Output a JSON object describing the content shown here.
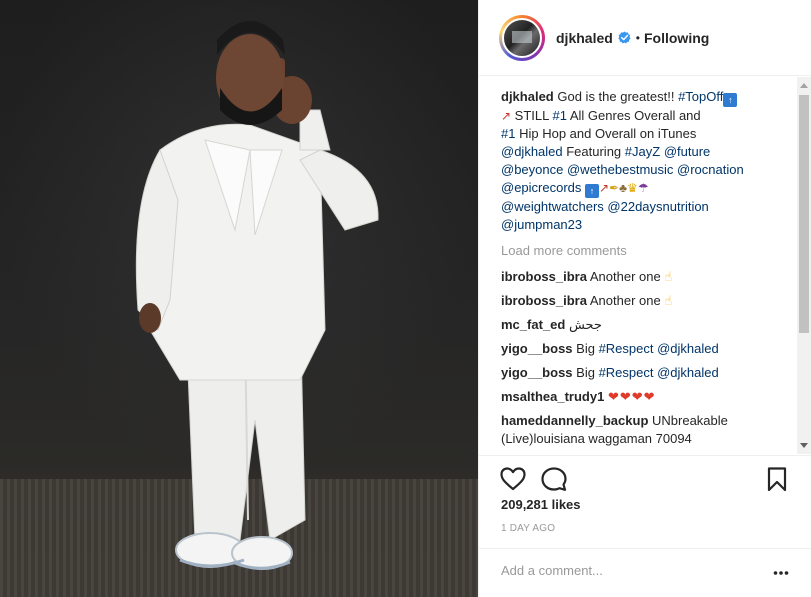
{
  "post": {
    "username": "djkhaled",
    "follow_status": "Following",
    "separator": "•",
    "caption": {
      "username": "djkhaled",
      "lines": [
        {
          "parts": [
            {
              "t": "God is the greatest!! "
            },
            {
              "t": "#TopOff",
              "tag": true
            },
            {
              "e": "top-badge"
            }
          ]
        },
        {
          "parts": [
            {
              "e": "rocket"
            },
            {
              "t": " STILL "
            },
            {
              "t": "#1",
              "tag": true
            },
            {
              "t": " All Genres Overall and"
            }
          ]
        },
        {
          "parts": [
            {
              "t": "#1",
              "tag": true
            },
            {
              "t": " Hip Hop and Overall on iTunes"
            }
          ]
        },
        {
          "parts": [
            {
              "t": "@djkhaled",
              "tag": true
            },
            {
              "t": " Featuring "
            },
            {
              "t": "#JayZ",
              "tag": true
            },
            {
              "t": " "
            },
            {
              "t": "@future",
              "tag": true
            }
          ]
        },
        {
          "parts": [
            {
              "t": "@beyonce",
              "tag": true
            },
            {
              "t": " "
            },
            {
              "t": "@wethebestmusic",
              "tag": true
            },
            {
              "t": " "
            },
            {
              "t": "@rocnation",
              "tag": true
            }
          ]
        },
        {
          "parts": [
            {
              "t": "@epicrecords",
              "tag": true
            },
            {
              "t": " "
            },
            {
              "e": "top-badge"
            },
            {
              "e": "rocket"
            },
            {
              "e": "key"
            },
            {
              "e": "lion"
            },
            {
              "e": "crown-face"
            },
            {
              "e": "umbrella"
            }
          ]
        },
        {
          "parts": [
            {
              "t": "@weightwatchers",
              "tag": true
            },
            {
              "t": " "
            },
            {
              "t": "@22daysnutrition",
              "tag": true
            }
          ]
        },
        {
          "parts": [
            {
              "t": "@jumpman23",
              "tag": true
            }
          ]
        }
      ]
    },
    "load_more": "Load more comments",
    "comments": [
      {
        "username": "ibroboss_ibra",
        "parts": [
          {
            "t": "Another one "
          },
          {
            "e": "hand"
          }
        ]
      },
      {
        "username": "ibroboss_ibra",
        "parts": [
          {
            "t": "Another one "
          },
          {
            "e": "hand"
          }
        ]
      },
      {
        "username": "mc_fat_ed",
        "parts": [
          {
            "t": "جحش"
          }
        ]
      },
      {
        "username": "yigo__boss",
        "parts": [
          {
            "t": "Big "
          },
          {
            "t": "#Respect",
            "tag": true
          },
          {
            "t": " "
          },
          {
            "t": "@djkhaled",
            "tag": true
          }
        ]
      },
      {
        "username": "yigo__boss",
        "parts": [
          {
            "t": "Big "
          },
          {
            "t": "#Respect",
            "tag": true
          },
          {
            "t": " "
          },
          {
            "t": "@djkhaled",
            "tag": true
          }
        ]
      },
      {
        "username": "msalthea_trudy1",
        "parts": [
          {
            "e": "heart"
          },
          {
            "e": "heart"
          },
          {
            "e": "heart"
          },
          {
            "e": "heart"
          }
        ]
      },
      {
        "username": "hameddannelly_backup",
        "parts": [
          {
            "t": "UNbreakable (Live)louisiana waggaman 70094"
          }
        ]
      }
    ],
    "likes": "209,281 likes",
    "timestamp": "1 DAY AGO",
    "add_comment_placeholder": "Add a comment...",
    "icons": {
      "like": "heart-outline-icon",
      "comment": "speech-bubble-icon",
      "save": "bookmark-icon",
      "more": "ellipsis-icon",
      "verified": "verified-badge-icon"
    },
    "colors": {
      "link": "#003569",
      "muted": "#999999",
      "verified": "#3897f0",
      "text": "#262626"
    }
  }
}
